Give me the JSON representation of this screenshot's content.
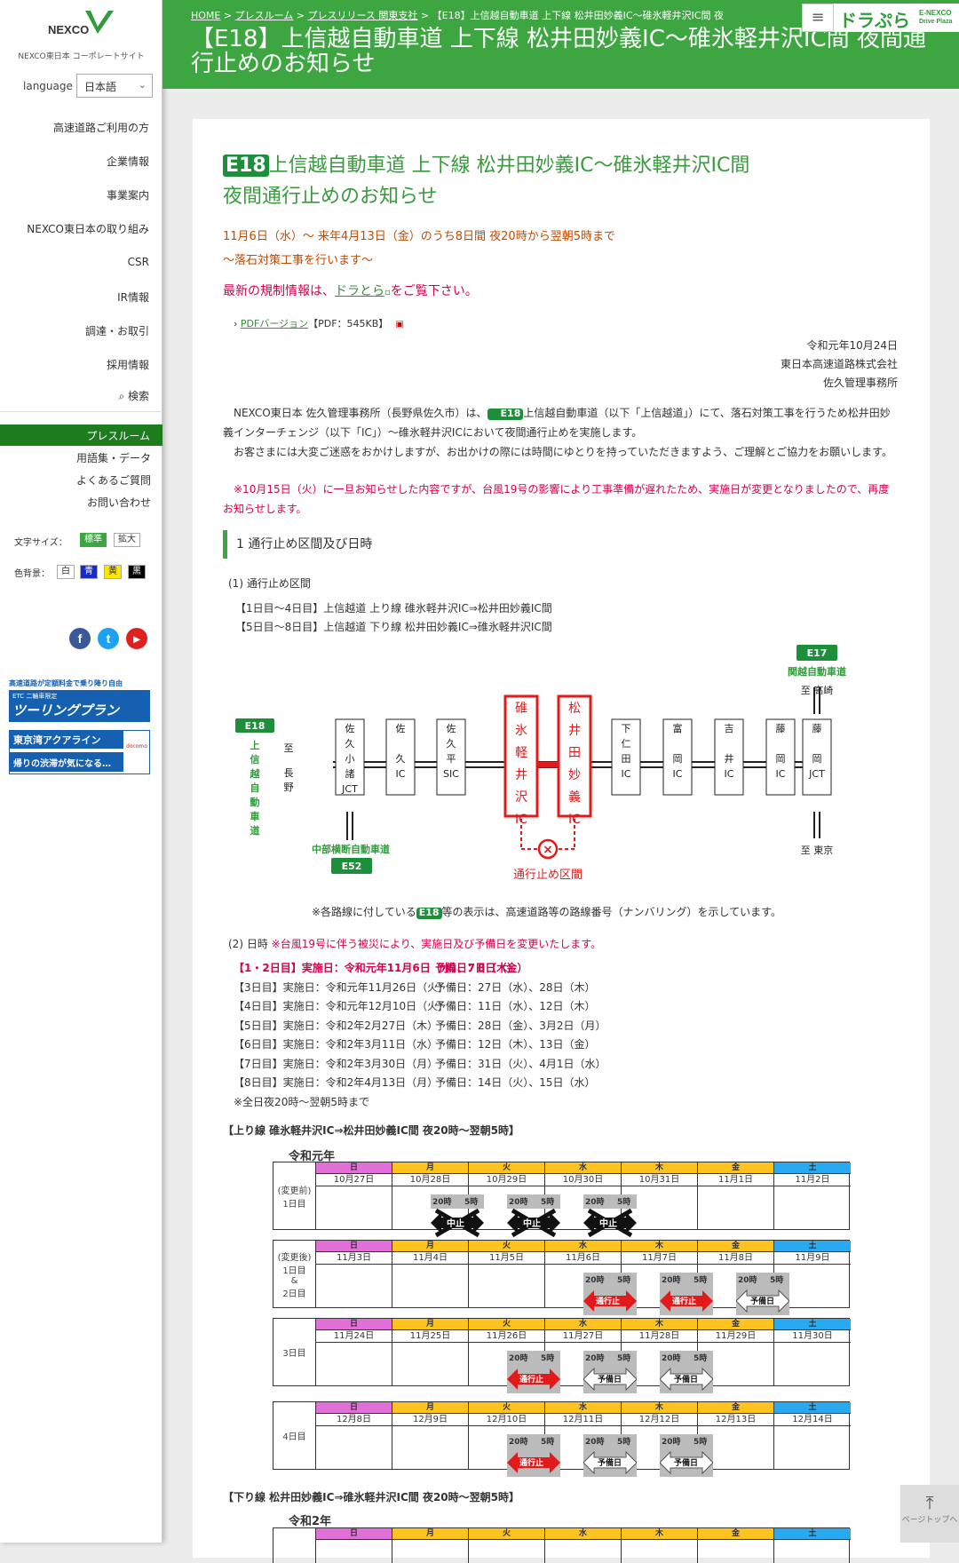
{
  "sidebar": {
    "logo_text": "NEXCO",
    "logo_sub": "東日本",
    "corp_site": "NEXCO東日本 コーポレートサイト",
    "language_label": "language",
    "language_value": "日本語",
    "nav": [
      "高速道路ご利用の方",
      "企業情報",
      "事業案内",
      "NEXCO東日本の取り組み",
      "CSR",
      "IR情報",
      "調達・お取引",
      "採用情報"
    ],
    "search": "検索",
    "pressroom": "プレスルーム",
    "sub_nav": [
      "用語集・データ",
      "よくあるご質問",
      "お問い合わせ"
    ],
    "font_size_label": "文字サイズ：",
    "font_size_options": [
      "標準",
      "拡大"
    ],
    "bg_label": "色背景：",
    "bg_options": [
      "白",
      "青",
      "黄",
      "黒"
    ],
    "banner1_top": "高速道路が定額料金で乗り降り自由",
    "banner1_badge": "ETC 二輪車限定",
    "banner1_main": "ツーリングプラン",
    "banner2_top": "東京湾アクアライン",
    "banner2_main": "帰りの渋滞が気になる…",
    "banner2_brand": "docomo"
  },
  "header": {
    "breadcrumb": [
      "HOME",
      "プレスルーム",
      "プレスリリース 関東支社",
      "【E18】上信越自動車道 上下線 松井田妙義IC～碓氷軽井沢IC間 夜"
    ],
    "title": "【E18】上信越自動車道 上下線 松井田妙義IC～碓氷軽井沢IC間 夜間通行止めのお知らせ",
    "menu_icon": "≡",
    "drapla_name": "ドラぷら",
    "drapla_sub1": "E-NEXCO",
    "drapla_sub2": "Drive Plaza"
  },
  "article": {
    "badge": "E18",
    "title_line1": "上信越自動車道 上下線 松井田妙義IC～碓氷軽井沢IC間",
    "title_line2": "夜間通行止めのお知らせ",
    "date_line1": "11月6日（水）～ 来年4月13日（金）のうち8日間 夜20時から翌朝5時まで",
    "date_line2": "～落石対策工事を行います～",
    "latest_pre": "最新の規制情報は、",
    "latest_link": "ドラとら",
    "latest_post": "をご覧下さい。",
    "pdf_link": "PDFバージョン",
    "pdf_info": "【PDF：545KB】",
    "sign_date": "令和元年10月24日",
    "sign_company": "東日本高速道路株式会社",
    "sign_office": "佐久管理事務所",
    "para1_a": "NEXCO東日本 佐久管理事務所（長野県佐久市）は、",
    "para1_b": "上信越自動車道（以下「上信越道」）にて、落石対策工事を行うため松井田妙義インターチェンジ（以下「IC」）～碓氷軽井沢ICにおいて夜間通行止めを実施します。",
    "para2": "お客さまには大変ご迷惑をおかけしますが、お出かけの際には時間にゆとりを持っていただきますよう、ご理解とご協力をお願いします。",
    "para3": "※10月15日（火）に一旦お知らせした内容ですが、台風19号の影響により工事準備が遅れたため、実施日が変更となりましたので、再度お知らせします。",
    "section1": "1 通行止め区間及び日時",
    "sub1": "(1) 通行止め区間",
    "up_line": "【1日目～4日目】上信越道 上り線 碓氷軽井沢IC⇒松井田妙義IC間",
    "down_line": "【5日目～8日目】上信越道 下り線 松井田妙義IC⇒碓氷軽井沢IC間",
    "map_note_pre": "※各路線に付している",
    "map_note_post": "等の表示は、高速道路等の路線番号（ナンバリング）を示しています。",
    "sub2": "(2) 日時",
    "sub2_note": "※台風19号に伴う被災により、実施日及び予備日を変更いたします。",
    "schedule": [
      {
        "day": "【1・2日目】実施日：令和元年11月6日（水）、7日（木）",
        "spare": "予備日：8日（金）",
        "red": true
      },
      {
        "day": "【3日目】実施日：令和元年11月26日（火）",
        "spare": "予備日：27日（水）、28日（木）",
        "red": false
      },
      {
        "day": "【4日目】実施日：令和元年12月10日（火）",
        "spare": "予備日：11日（水）、12日（木）",
        "red": false
      },
      {
        "day": "【5日目】実施日：令和2年2月27日（木）",
        "spare": "予備日：28日（金）、3月2日（月）",
        "red": false
      },
      {
        "day": "【6日目】実施日：令和2年3月11日（水）",
        "spare": "予備日：12日（木）、13日（金）",
        "red": false
      },
      {
        "day": "【7日目】実施日：令和2年3月30日（月）",
        "spare": "予備日：31日（火）、4月1日（水）",
        "red": false
      },
      {
        "day": "【8日目】実施日：令和2年4月13日（月）",
        "spare": "予備日：14日（火）、15日（水）",
        "red": false
      }
    ],
    "schedule_note": "※全日夜20時～翌朝5時まで",
    "up_block_title": "【上り線 碓氷軽井沢IC⇒松井田妙義IC間 夜20時～翌朝5時】",
    "down_block_title": "【下り線 松井田妙義IC⇒碓氷軽井沢IC間 夜20時～翌朝5時】",
    "era1": "令和元年",
    "era2": "令和2年",
    "weekdays": [
      "日",
      "月",
      "火",
      "水",
      "木",
      "金",
      "土"
    ],
    "weekday_colors": [
      "#e070d8",
      "#ffc31f",
      "#ffc31f",
      "#ffc31f",
      "#ffc31f",
      "#ffc31f",
      "#29aaf0"
    ],
    "time_start": "20時",
    "time_end": "5時",
    "mark_cancel": "中止",
    "mark_closed": "通行止",
    "mark_spare": "予備日",
    "cal_weeks": [
      {
        "label": "(変更前)\n1日目",
        "dates": [
          "10月27日",
          "10月28日",
          "10月29日",
          "10月30日",
          "10月31日",
          "11月1日",
          "11月2日"
        ],
        "marks": [
          [
            "cancel",
            1
          ],
          [
            "cancel",
            2
          ],
          [
            "cancel",
            3
          ]
        ]
      },
      {
        "label": "(変更後)\n1日目\n&\n2日目",
        "dates": [
          "11月3日",
          "11月4日",
          "11月5日",
          "11月6日",
          "11月7日",
          "11月8日",
          "11月9日"
        ],
        "marks": [
          [
            "closed",
            3
          ],
          [
            "closed",
            4
          ],
          [
            "spare",
            5
          ]
        ]
      },
      {
        "label": "3日目",
        "dates": [
          "11月24日",
          "11月25日",
          "11月26日",
          "11月27日",
          "11月28日",
          "11月29日",
          "11月30日"
        ],
        "marks": [
          [
            "closed",
            2
          ],
          [
            "spare",
            3
          ],
          [
            "spare",
            4
          ]
        ]
      },
      {
        "label": "4日目",
        "dates": [
          "12月8日",
          "12月9日",
          "12月10日",
          "12月11日",
          "12月12日",
          "12月13日",
          "12月14日"
        ],
        "marks": [
          [
            "closed",
            2
          ],
          [
            "spare",
            3
          ],
          [
            "spare",
            4
          ]
        ]
      }
    ]
  },
  "map": {
    "left_route_badge": "E18",
    "left_route_name": "上信越自動車道",
    "left_dest_to": "至",
    "left_dest": "長野",
    "bottom_route_name": "中部横断自動車道",
    "bottom_route_badge": "E52",
    "top_route_badge": "E17",
    "top_route_name": "関越自動車道",
    "top_dest": "至 高崎",
    "bottom_dest": "至 東京",
    "closed_label": "通行止め区間",
    "stations": [
      {
        "name": "佐久小諸JCT",
        "lines": [
          "佐",
          "久",
          "小",
          "諸",
          "JCT"
        ],
        "red": false
      },
      {
        "name": "佐久IC",
        "lines": [
          "佐",
          "",
          "久",
          "IC"
        ],
        "red": false
      },
      {
        "name": "佐久平SIC",
        "lines": [
          "佐",
          "久",
          "平",
          "SIC"
        ],
        "red": false
      },
      {
        "name": "碓氷軽井沢IC",
        "lines": [
          "碓",
          "氷",
          "軽",
          "井",
          "沢",
          "IC"
        ],
        "red": true
      },
      {
        "name": "松井田妙義IC",
        "lines": [
          "松",
          "井",
          "田",
          "妙",
          "義",
          "IC"
        ],
        "red": true
      },
      {
        "name": "下仁田IC",
        "lines": [
          "下",
          "仁",
          "田",
          "IC"
        ],
        "red": false
      },
      {
        "name": "富岡IC",
        "lines": [
          "富",
          "",
          "岡",
          "IC"
        ],
        "red": false
      },
      {
        "name": "吉井IC",
        "lines": [
          "吉",
          "",
          "井",
          "IC"
        ],
        "red": false
      },
      {
        "name": "藤岡IC",
        "lines": [
          "藤",
          "",
          "岡",
          "IC"
        ],
        "red": false
      },
      {
        "name": "藤岡JCT",
        "lines": [
          "藤",
          "",
          "岡",
          "JCT"
        ],
        "red": false
      }
    ]
  },
  "pagetop": "ページトップへ"
}
